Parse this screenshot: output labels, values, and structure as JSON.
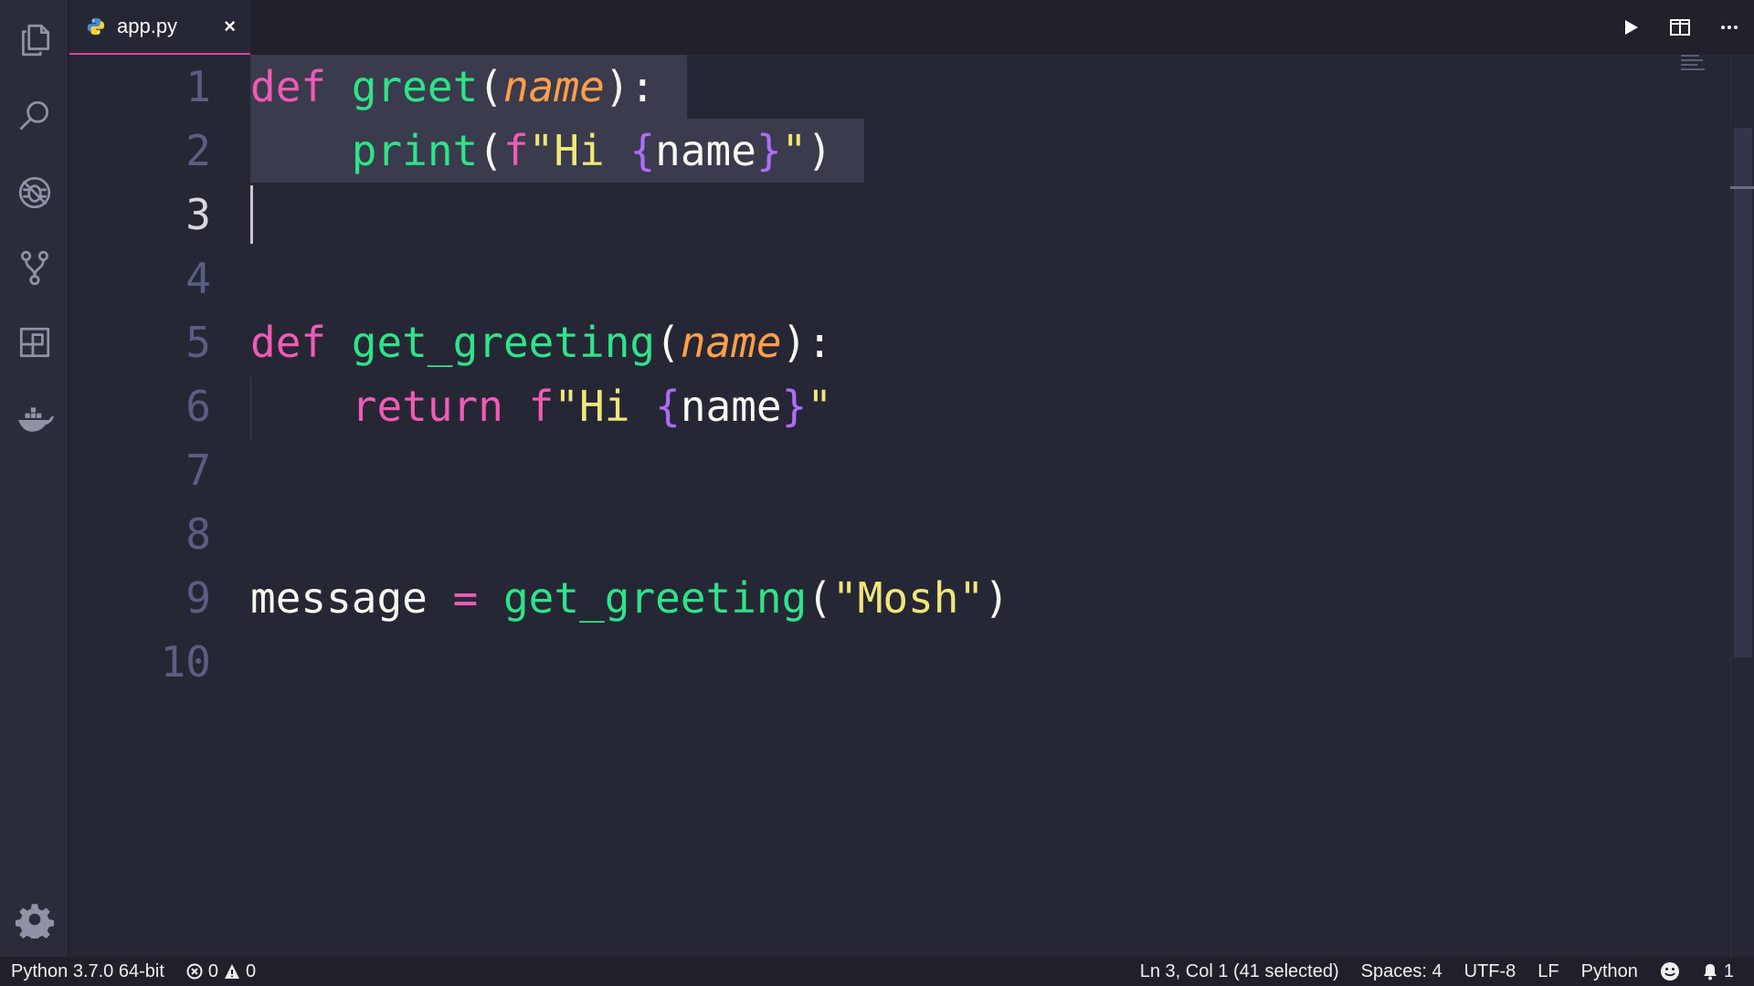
{
  "colors": {
    "editor_bg": "#262735",
    "activity_bg": "#2b2c3a",
    "tab_accent": "#e03fa0",
    "keyword": "#f15bb5",
    "function": "#2fe38a",
    "parameter": "#ff9f4a",
    "string": "#f0e67a",
    "brace": "#b06bff"
  },
  "activity_bar": {
    "items": [
      "explorer-icon",
      "search-icon",
      "debug-icon",
      "source-control-icon",
      "extensions-icon",
      "docker-icon"
    ],
    "bottom": "gear-icon"
  },
  "tab": {
    "label": "app.py",
    "close": "×",
    "icon": "python-icon"
  },
  "top_actions": [
    "run-icon",
    "split-editor-icon",
    "more-icon"
  ],
  "editor": {
    "line_numbers": [
      "1",
      "2",
      "3",
      "4",
      "5",
      "6",
      "7",
      "8",
      "9",
      "10"
    ],
    "active_line": "3",
    "lines": {
      "l1": {
        "kw": "def",
        "fn": "greet",
        "open": "(",
        "param": "name",
        "close": "):"
      },
      "l2": {
        "fn": "print",
        "open": "(",
        "fprefix": "f",
        "q1": "\"Hi ",
        "b1": "{",
        "var": "name",
        "b2": "}",
        "q2": "\"",
        "close": ")"
      },
      "l5": {
        "kw": "def",
        "fn": "get_greeting",
        "open": "(",
        "param": "name",
        "close": "):"
      },
      "l6": {
        "kw": "return",
        "fprefix": "f",
        "q1": "\"Hi ",
        "b1": "{",
        "var": "name",
        "b2": "}",
        "q2": "\""
      },
      "l9": {
        "var": "message",
        "op": "=",
        "fn": "get_greeting",
        "open": "(",
        "str": "\"Mosh\"",
        "close": ")"
      }
    }
  },
  "status_bar": {
    "interpreter": "Python 3.7.0 64-bit",
    "errors": "0",
    "warnings": "0",
    "position": "Ln 3, Col 1 (41 selected)",
    "spaces": "Spaces: 4",
    "encoding": "UTF-8",
    "eol": "LF",
    "language": "Python",
    "notifications": "1"
  }
}
